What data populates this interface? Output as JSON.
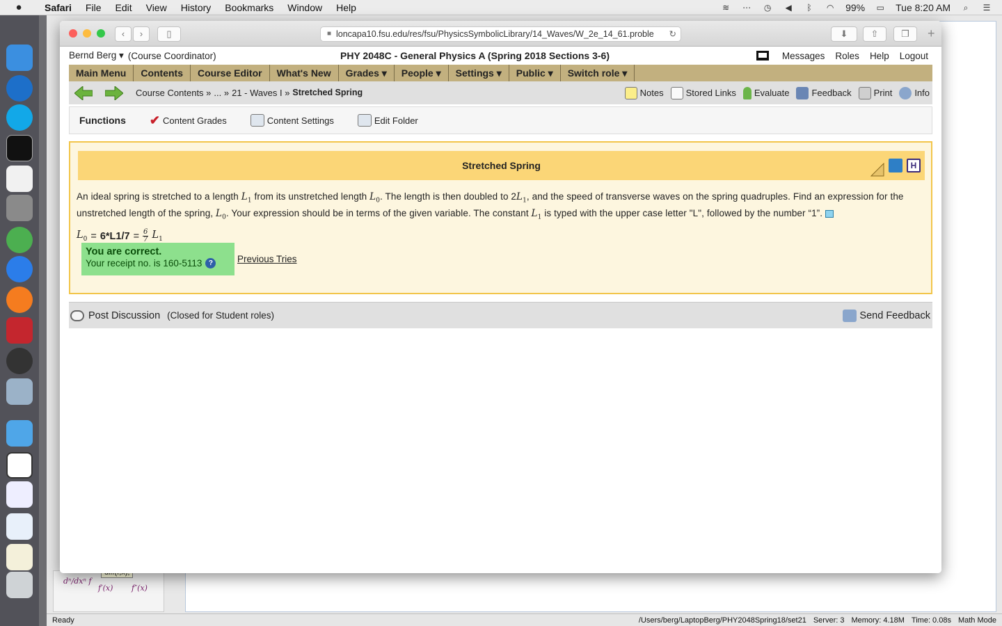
{
  "menubar": {
    "apple_icon": "apple-icon",
    "app": "Safari",
    "items": [
      "File",
      "Edit",
      "View",
      "History",
      "Bookmarks",
      "Window",
      "Help"
    ],
    "battery": "99%",
    "clock": "Tue 8:20 AM"
  },
  "background_app": {
    "status_left": "Ready",
    "path": "/Users/berg/LaptopBerg/PHY2048Spring18/set21",
    "server": "Server: 3",
    "memory": "Memory: 4.18M",
    "time": "Time: 0.08s",
    "mode": "Math Mode",
    "tooltip": "diff(f,x);"
  },
  "browser": {
    "url": "loncapa10.fsu.edu/res/fsu/PhysicsSymbolicLibrary/14_Waves/W_2e_14_61.proble"
  },
  "userbar": {
    "user": "Bernd Berg ▾",
    "role": "(Course Coordinator)",
    "course": "PHY 2048C - General Physics A (Spring 2018 Sections 3-6)",
    "links": [
      "Messages",
      "Roles",
      "Help",
      "Logout"
    ]
  },
  "mainnav": [
    "Main Menu",
    "Contents",
    "Course Editor",
    "What's New",
    "Grades ▾",
    "People ▾",
    "Settings ▾",
    "Public ▾",
    "Switch role ▾"
  ],
  "breadcrumb": {
    "items": [
      "Course Contents »",
      "... »",
      "21 - Waves I »"
    ],
    "current": "Stretched Spring"
  },
  "tools": [
    "Notes",
    "Stored Links",
    "Evaluate",
    "Feedback",
    "Print",
    "Info"
  ],
  "functions": {
    "title": "Functions",
    "items": [
      "Content Grades",
      "Content Settings",
      "Edit Folder"
    ]
  },
  "problem": {
    "title": "Stretched Spring",
    "text_a": "An ideal spring is stretched to a length",
    "text_b": "from its unstretched length",
    "text_c": ". The length is then doubled to 2",
    "text_d": ", and the speed of transverse waves on the spring quadruples. Find an expression for the unstretched length of the spring,",
    "text_e": ". Your expression should be in terms of the given variable. The constant",
    "text_f": "is typed with the upper case letter \"L\", followed by the number “1”.",
    "var_L": "L",
    "sub_1": "1",
    "sub_0": "0",
    "answer_value": "6*L1/7",
    "frac_num": "6",
    "frac_den": "7",
    "correct_title": "You are correct.",
    "receipt": "Your receipt no. is 160-5113",
    "previous_tries": "Previous Tries"
  },
  "discussion": {
    "post": "Post Discussion",
    "closed": "(Closed for Student roles)",
    "send_feedback": "Send Feedback"
  }
}
